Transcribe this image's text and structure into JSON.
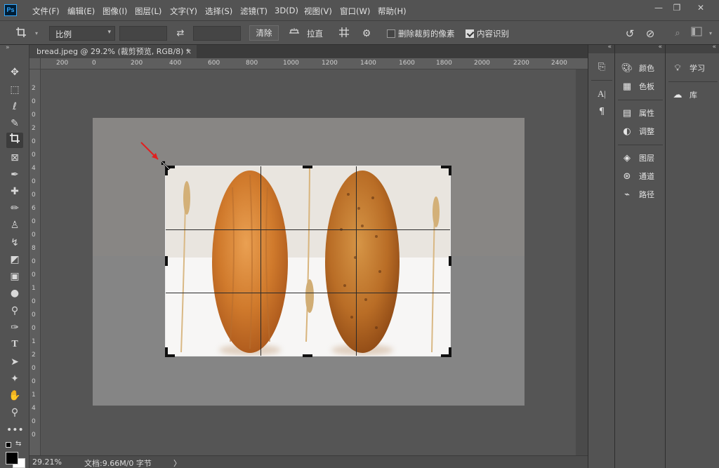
{
  "app": {
    "logo": "Ps"
  },
  "menu": {
    "items": [
      "文件(F)",
      "编辑(E)",
      "图像(I)",
      "图层(L)",
      "文字(Y)",
      "选择(S)",
      "滤镜(T)",
      "3D(D)",
      "视图(V)",
      "窗口(W)",
      "帮助(H)"
    ]
  },
  "window_controls": {
    "minimize": "—",
    "restore": "❐",
    "close": "✕"
  },
  "options": {
    "ratio_select": "比例",
    "width_value": "",
    "height_value": "",
    "clear_button": "清除",
    "straighten_label": "拉直",
    "delete_cropped_label": "删除裁剪的像素",
    "delete_cropped_checked": false,
    "content_aware_label": "内容识别",
    "content_aware_checked": true
  },
  "document": {
    "tab_title": "bread.jpeg @ 29.2% (裁剪预览, RGB/8) *",
    "close_label": "×"
  },
  "ruler": {
    "h_labels": [
      "200",
      "0",
      "200",
      "400",
      "600",
      "800",
      "1000",
      "1200",
      "1400",
      "1600",
      "1800",
      "2000",
      "2200",
      "2400"
    ],
    "v_labels": [
      "2",
      "0",
      "0",
      "2",
      "0",
      "0",
      "4",
      "0",
      "0",
      "6",
      "0",
      "0",
      "8",
      "0",
      "0",
      "1",
      "0",
      "0",
      "0",
      "1",
      "2",
      "0",
      "0",
      "1",
      "4",
      "0",
      "0"
    ]
  },
  "status": {
    "zoom": "29.21%",
    "doc_info": "文档:9.66M/0 字节",
    "arrow": "〉"
  },
  "panels": {
    "col1": [
      {
        "icon": "palette-icon",
        "label": "颜色"
      },
      {
        "icon": "swatches-icon",
        "label": "色板"
      },
      {
        "icon": "properties-icon",
        "label": "属性"
      },
      {
        "icon": "adjustments-icon",
        "label": "调整"
      },
      {
        "icon": "layers-icon",
        "label": "图层"
      },
      {
        "icon": "channels-icon",
        "label": "通道"
      },
      {
        "icon": "paths-icon",
        "label": "路径"
      }
    ],
    "col2": [
      {
        "icon": "learn-icon",
        "label": "学习"
      },
      {
        "icon": "libraries-icon",
        "label": "库"
      }
    ]
  },
  "colors": {
    "accent": "#31a8ff",
    "arrow": "#e02020"
  }
}
